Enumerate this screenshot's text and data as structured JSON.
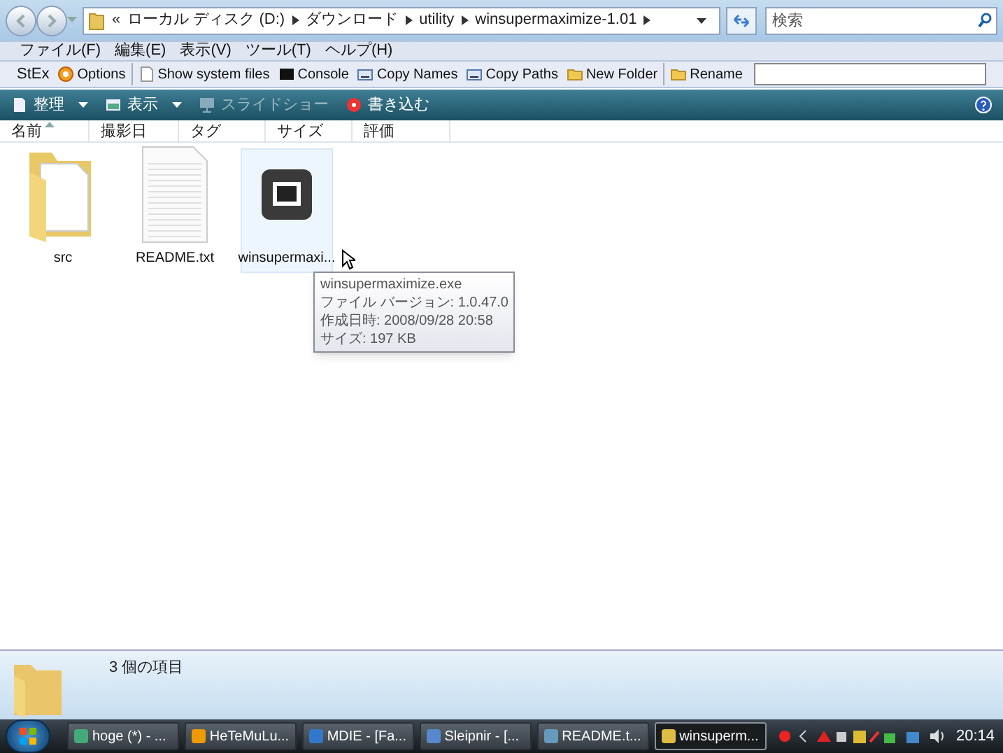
{
  "address_bar": {
    "crumbs": [
      "ローカル ディスク (D:)",
      "ダウンロード",
      "utility",
      "winsupermaximize-1.01"
    ],
    "overflow": "«"
  },
  "search": {
    "placeholder": "検索"
  },
  "menu": [
    "ファイル(F)",
    "編集(E)",
    "表示(V)",
    "ツール(T)",
    "ヘルプ(H)"
  ],
  "stex_toolbar": {
    "label": "StEx",
    "buttons": [
      {
        "label": "Options",
        "kind": "options"
      },
      {
        "label": "Show system files",
        "kind": "page"
      },
      {
        "label": "Console",
        "kind": "console"
      },
      {
        "label": "Copy Names",
        "kind": "copy"
      },
      {
        "label": "Copy Paths",
        "kind": "copy"
      },
      {
        "label": "New Folder",
        "kind": "folder"
      },
      {
        "label": "Rename",
        "kind": "folder"
      }
    ]
  },
  "command_bar": [
    {
      "label": "整理",
      "kind": "organize",
      "dropdown": true,
      "disabled": false
    },
    {
      "label": "表示",
      "kind": "view",
      "dropdown": true,
      "disabled": false
    },
    {
      "label": "スライドショー",
      "kind": "slideshow",
      "dropdown": false,
      "disabled": true
    },
    {
      "label": "書き込む",
      "kind": "burn",
      "dropdown": false,
      "disabled": false
    }
  ],
  "columns": [
    {
      "label": "名前",
      "sorted": true
    },
    {
      "label": "撮影日",
      "sorted": false
    },
    {
      "label": "タグ",
      "sorted": false
    },
    {
      "label": "サイズ",
      "sorted": false
    },
    {
      "label": "評価",
      "sorted": false
    }
  ],
  "files": [
    {
      "name": "src",
      "kind": "folder",
      "hovered": false
    },
    {
      "name": "README.txt",
      "kind": "text",
      "hovered": false
    },
    {
      "name": "winsupermaxi...",
      "kind": "exe",
      "hovered": true
    }
  ],
  "tooltip": {
    "lines": [
      "winsupermaximize.exe",
      "ファイル バージョン: 1.0.47.0",
      "作成日時: 2008/09/28 20:58",
      "サイズ: 197 KB"
    ]
  },
  "details": {
    "text": "3 個の項目"
  },
  "taskbar": {
    "buttons": [
      {
        "label": "hoge (*) - ...",
        "selected": false
      },
      {
        "label": "HeTeMuLu...",
        "selected": false
      },
      {
        "label": "MDIE - [Fa...",
        "selected": false
      },
      {
        "label": "Sleipnir - [...",
        "selected": false
      },
      {
        "label": "README.t...",
        "selected": false
      },
      {
        "label": "winsuperm...",
        "selected": true
      }
    ],
    "clock": "20:14"
  }
}
